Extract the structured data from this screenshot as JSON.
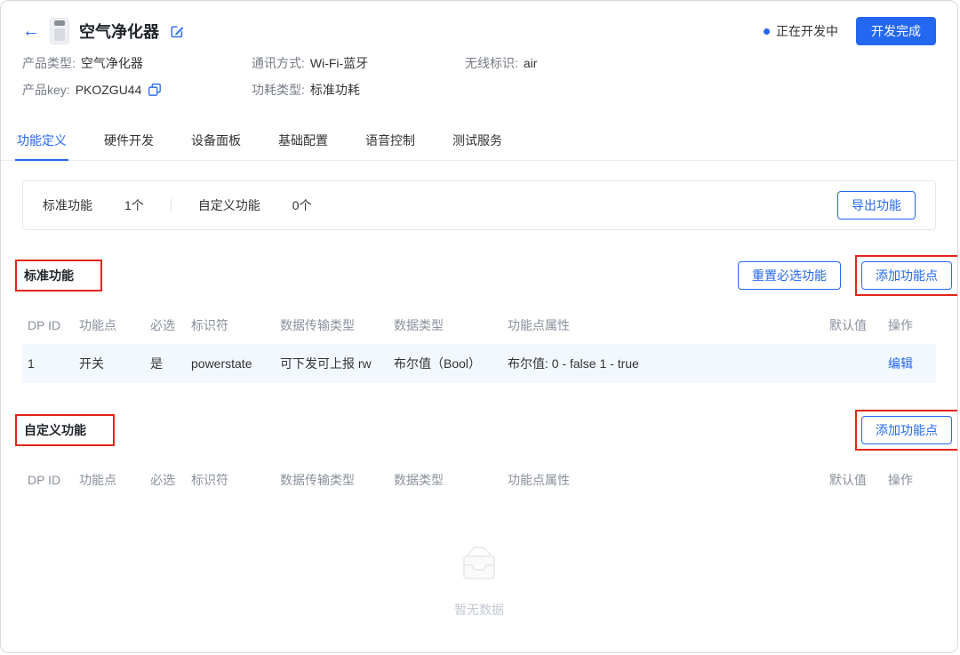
{
  "colors": {
    "accent": "#2468f2",
    "annotation": "#e1251b",
    "row_highlight": "#f3f8ff"
  },
  "header": {
    "back_icon": "←",
    "title": "空气净化器",
    "status_label": "正在开发中",
    "complete_button": "开发完成"
  },
  "product_info": {
    "type_label": "产品类型:",
    "type_value": "空气净化器",
    "comm_label": "通讯方式:",
    "comm_value": "Wi-Fi-蓝牙",
    "wireless_label": "无线标识:",
    "wireless_value": "air",
    "key_label": "产品key:",
    "key_value": "PKOZGU44",
    "power_label": "功耗类型:",
    "power_value": "标准功耗"
  },
  "tabs": {
    "items": [
      "功能定义",
      "硬件开发",
      "设备面板",
      "基础配置",
      "语音控制",
      "测试服务"
    ],
    "active": "功能定义"
  },
  "summary": {
    "standard_label": "标准功能",
    "standard_count": "1个",
    "custom_label": "自定义功能",
    "custom_count": "0个",
    "export_button": "导出功能"
  },
  "standard_section": {
    "title": "标准功能",
    "reset_button": "重置必选功能",
    "add_button": "添加功能点"
  },
  "custom_section": {
    "title": "自定义功能",
    "add_button": "添加功能点"
  },
  "table": {
    "headers": [
      "DP ID",
      "功能点",
      "必选",
      "标识符",
      "数据传输类型",
      "数据类型",
      "功能点属性",
      "默认值",
      "操作"
    ]
  },
  "standard_row": {
    "dp_id": "1",
    "name": "开关",
    "required": "是",
    "identifier": "powerstate",
    "transfer": "可下发可上报 rw",
    "data_type": "布尔值（Bool）",
    "property": "布尔值: 0 - false 1 - true",
    "default": "",
    "action": "编辑"
  },
  "empty_state": {
    "text": "暂无数据"
  }
}
